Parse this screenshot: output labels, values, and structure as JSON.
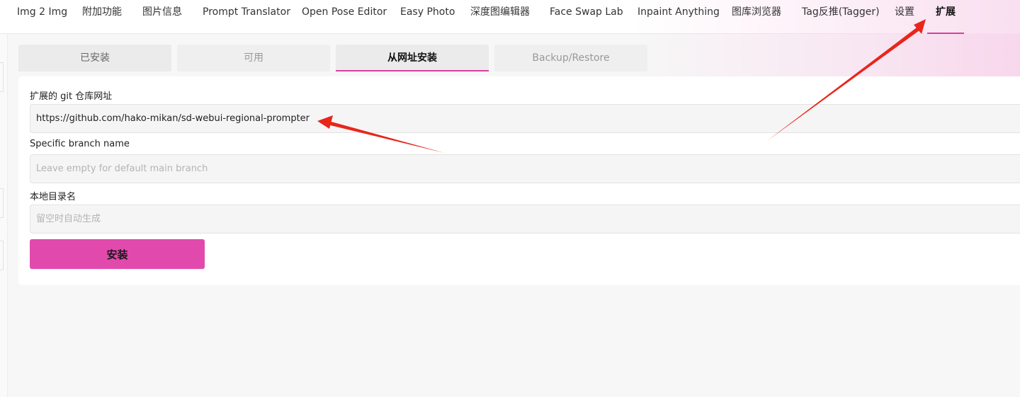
{
  "nav": {
    "tabs": [
      {
        "label": "Img 2 Img"
      },
      {
        "label": "附加功能"
      },
      {
        "label": "图片信息"
      },
      {
        "label": "Prompt Translator"
      },
      {
        "label": "Open Pose Editor"
      },
      {
        "label": "Easy Photo"
      },
      {
        "label": "深度图编辑器"
      },
      {
        "label": "Face Swap Lab"
      },
      {
        "label": "Inpaint Anything"
      },
      {
        "label": "图库浏览器"
      },
      {
        "label": "Tag反推(Tagger)"
      },
      {
        "label": "设置"
      },
      {
        "label": "扩展"
      }
    ],
    "active": "扩展"
  },
  "subtabs": [
    {
      "label": "已安装"
    },
    {
      "label": "可用"
    },
    {
      "label": "从网址安装"
    },
    {
      "label": "Backup/Restore"
    }
  ],
  "form": {
    "url_label": "扩展的 git 仓库网址",
    "url_value": "https://github.com/hako-mikan/sd-webui-regional-prompter",
    "branch_label": "Specific branch name",
    "branch_placeholder": "Leave empty for default main branch",
    "dir_label": "本地目录名",
    "dir_placeholder": "留空时自动生成",
    "install_label": "安装"
  },
  "colors": {
    "accent": "#e14aac",
    "annotation_arrow": "#e8261b"
  }
}
